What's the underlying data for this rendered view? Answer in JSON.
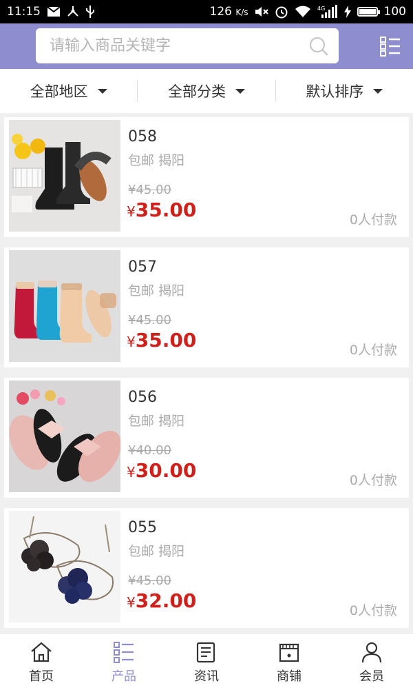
{
  "status": {
    "time": "11:15",
    "speed": "126",
    "speed_unit": "K/s",
    "net": "4G",
    "battery": "100",
    "battery_level": 1.0
  },
  "header": {
    "search_placeholder": "请输入商品关键字",
    "search_icon": "search-icon",
    "menu_icon": "grid-menu-icon",
    "accent_color": "#8d8dcf"
  },
  "filters": [
    "全部地区",
    "全部分类",
    "默认排序"
  ],
  "products": [
    {
      "name": "058",
      "shipping": "包邮 揭阳",
      "old_price": "¥45.00",
      "currency": "¥",
      "price": "35.00",
      "paid": "0人付款",
      "image": "rain-boots"
    },
    {
      "name": "057",
      "shipping": "包邮 揭阳",
      "old_price": "¥45.00",
      "currency": "¥",
      "price": "35.00",
      "paid": "0人付款",
      "image": "short-rain-boots"
    },
    {
      "name": "056",
      "shipping": "包邮 揭阳",
      "old_price": "¥40.00",
      "currency": "¥",
      "price": "30.00",
      "paid": "0人付款",
      "image": "bow-flip-flops"
    },
    {
      "name": "055",
      "shipping": "包邮 揭阳",
      "old_price": "¥45.00",
      "currency": "¥",
      "price": "32.00",
      "paid": "0人付款",
      "image": "flower-sandals"
    }
  ],
  "nav": [
    {
      "label": "首页",
      "icon": "home-icon"
    },
    {
      "label": "产品",
      "icon": "product-list-icon",
      "active": true
    },
    {
      "label": "资讯",
      "icon": "news-icon"
    },
    {
      "label": "商铺",
      "icon": "shop-icon"
    },
    {
      "label": "会员",
      "icon": "user-icon"
    }
  ]
}
